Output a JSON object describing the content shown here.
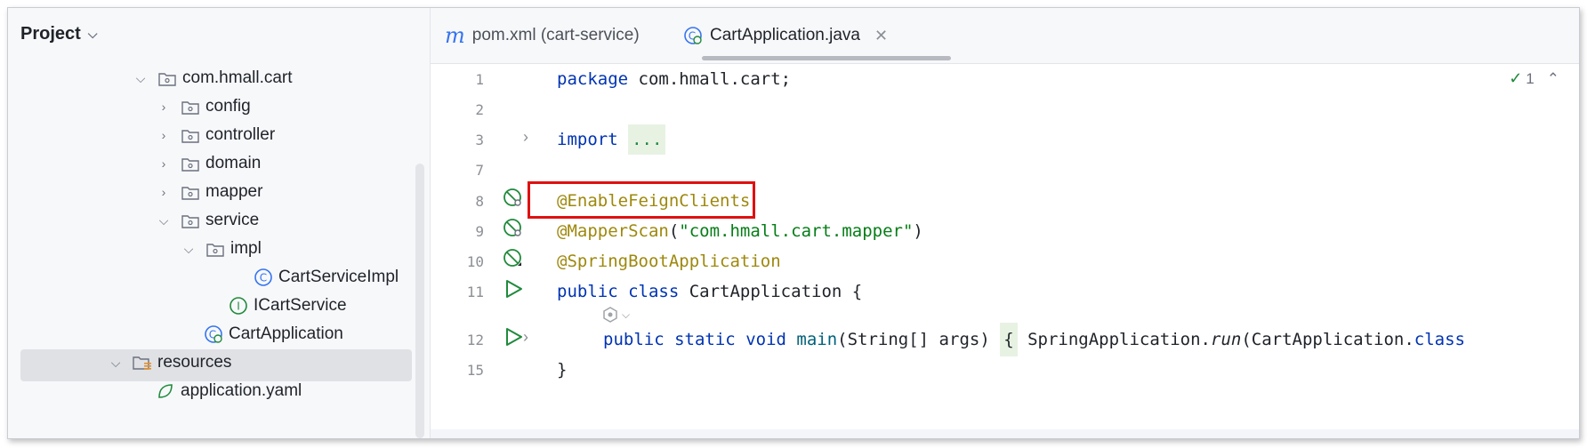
{
  "sidebar": {
    "title": "Project",
    "tree": [
      {
        "label": "com.hmall.cart"
      },
      {
        "label": "config"
      },
      {
        "label": "controller"
      },
      {
        "label": "domain"
      },
      {
        "label": "mapper"
      },
      {
        "label": "service"
      },
      {
        "label": "impl"
      },
      {
        "label": "CartServiceImpl"
      },
      {
        "label": "ICartService"
      },
      {
        "label": "CartApplication"
      },
      {
        "label": "resources"
      },
      {
        "label": "application.yaml"
      }
    ]
  },
  "tabs": [
    {
      "label": "pom.xml (cart-service)"
    },
    {
      "label": "CartApplication.java"
    }
  ],
  "editor": {
    "inspection_count": "1",
    "lines": {
      "l1": {
        "num": "1",
        "kw": "package",
        "rest": " com.hmall.cart;"
      },
      "l2": {
        "num": "2"
      },
      "l3": {
        "num": "3",
        "kw": "import",
        "fold": "..."
      },
      "l7": {
        "num": "7"
      },
      "l8": {
        "num": "8",
        "ann": "@EnableFeignClients"
      },
      "l9": {
        "num": "9",
        "ann": "@MapperScan",
        "open": "(",
        "str": "\"com.hmall.cart.mapper\"",
        "close": ")"
      },
      "l10": {
        "num": "10",
        "ann": "@SpringBootApplication"
      },
      "l11": {
        "num": "11",
        "kw1": "public",
        "kw2": "class",
        "rest": " CartApplication {"
      },
      "l12": {
        "num": "12",
        "kw1": "public",
        "kw2": "static",
        "kw3": "void",
        "m": "main",
        "sig": "(String[] args) ",
        "brace": "{",
        "body": " SpringApplication.",
        "run": "run",
        "tail": "(CartApplication.",
        "cls": "class"
      },
      "l15": {
        "num": "15",
        "rest": "}"
      }
    }
  }
}
